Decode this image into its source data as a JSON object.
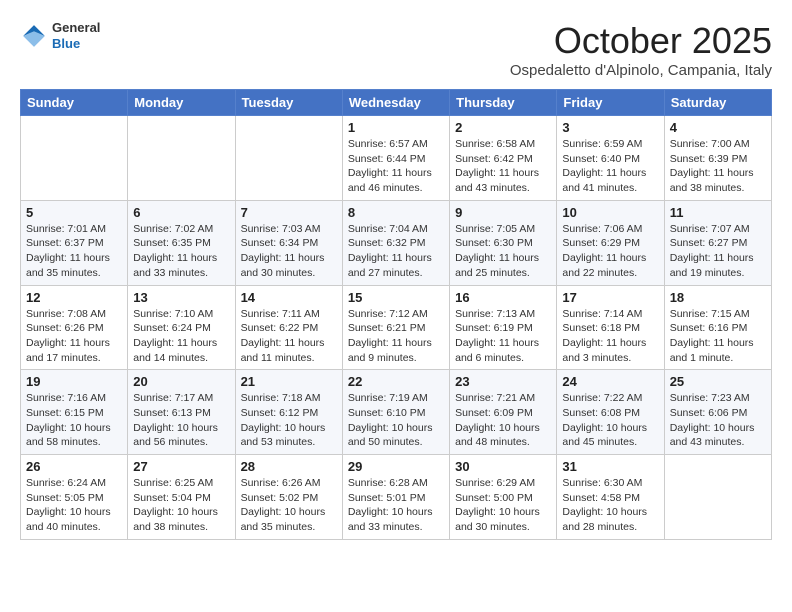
{
  "header": {
    "logo": {
      "general": "General",
      "blue": "Blue"
    },
    "title": "October 2025",
    "subtitle": "Ospedaletto d'Alpinolo, Campania, Italy"
  },
  "calendar": {
    "days_of_week": [
      "Sunday",
      "Monday",
      "Tuesday",
      "Wednesday",
      "Thursday",
      "Friday",
      "Saturday"
    ],
    "weeks": [
      [
        {
          "day": "",
          "info": ""
        },
        {
          "day": "",
          "info": ""
        },
        {
          "day": "",
          "info": ""
        },
        {
          "day": "1",
          "info": "Sunrise: 6:57 AM\nSunset: 6:44 PM\nDaylight: 11 hours and 46 minutes."
        },
        {
          "day": "2",
          "info": "Sunrise: 6:58 AM\nSunset: 6:42 PM\nDaylight: 11 hours and 43 minutes."
        },
        {
          "day": "3",
          "info": "Sunrise: 6:59 AM\nSunset: 6:40 PM\nDaylight: 11 hours and 41 minutes."
        },
        {
          "day": "4",
          "info": "Sunrise: 7:00 AM\nSunset: 6:39 PM\nDaylight: 11 hours and 38 minutes."
        }
      ],
      [
        {
          "day": "5",
          "info": "Sunrise: 7:01 AM\nSunset: 6:37 PM\nDaylight: 11 hours and 35 minutes."
        },
        {
          "day": "6",
          "info": "Sunrise: 7:02 AM\nSunset: 6:35 PM\nDaylight: 11 hours and 33 minutes."
        },
        {
          "day": "7",
          "info": "Sunrise: 7:03 AM\nSunset: 6:34 PM\nDaylight: 11 hours and 30 minutes."
        },
        {
          "day": "8",
          "info": "Sunrise: 7:04 AM\nSunset: 6:32 PM\nDaylight: 11 hours and 27 minutes."
        },
        {
          "day": "9",
          "info": "Sunrise: 7:05 AM\nSunset: 6:30 PM\nDaylight: 11 hours and 25 minutes."
        },
        {
          "day": "10",
          "info": "Sunrise: 7:06 AM\nSunset: 6:29 PM\nDaylight: 11 hours and 22 minutes."
        },
        {
          "day": "11",
          "info": "Sunrise: 7:07 AM\nSunset: 6:27 PM\nDaylight: 11 hours and 19 minutes."
        }
      ],
      [
        {
          "day": "12",
          "info": "Sunrise: 7:08 AM\nSunset: 6:26 PM\nDaylight: 11 hours and 17 minutes."
        },
        {
          "day": "13",
          "info": "Sunrise: 7:10 AM\nSunset: 6:24 PM\nDaylight: 11 hours and 14 minutes."
        },
        {
          "day": "14",
          "info": "Sunrise: 7:11 AM\nSunset: 6:22 PM\nDaylight: 11 hours and 11 minutes."
        },
        {
          "day": "15",
          "info": "Sunrise: 7:12 AM\nSunset: 6:21 PM\nDaylight: 11 hours and 9 minutes."
        },
        {
          "day": "16",
          "info": "Sunrise: 7:13 AM\nSunset: 6:19 PM\nDaylight: 11 hours and 6 minutes."
        },
        {
          "day": "17",
          "info": "Sunrise: 7:14 AM\nSunset: 6:18 PM\nDaylight: 11 hours and 3 minutes."
        },
        {
          "day": "18",
          "info": "Sunrise: 7:15 AM\nSunset: 6:16 PM\nDaylight: 11 hours and 1 minute."
        }
      ],
      [
        {
          "day": "19",
          "info": "Sunrise: 7:16 AM\nSunset: 6:15 PM\nDaylight: 10 hours and 58 minutes."
        },
        {
          "day": "20",
          "info": "Sunrise: 7:17 AM\nSunset: 6:13 PM\nDaylight: 10 hours and 56 minutes."
        },
        {
          "day": "21",
          "info": "Sunrise: 7:18 AM\nSunset: 6:12 PM\nDaylight: 10 hours and 53 minutes."
        },
        {
          "day": "22",
          "info": "Sunrise: 7:19 AM\nSunset: 6:10 PM\nDaylight: 10 hours and 50 minutes."
        },
        {
          "day": "23",
          "info": "Sunrise: 7:21 AM\nSunset: 6:09 PM\nDaylight: 10 hours and 48 minutes."
        },
        {
          "day": "24",
          "info": "Sunrise: 7:22 AM\nSunset: 6:08 PM\nDaylight: 10 hours and 45 minutes."
        },
        {
          "day": "25",
          "info": "Sunrise: 7:23 AM\nSunset: 6:06 PM\nDaylight: 10 hours and 43 minutes."
        }
      ],
      [
        {
          "day": "26",
          "info": "Sunrise: 6:24 AM\nSunset: 5:05 PM\nDaylight: 10 hours and 40 minutes."
        },
        {
          "day": "27",
          "info": "Sunrise: 6:25 AM\nSunset: 5:04 PM\nDaylight: 10 hours and 38 minutes."
        },
        {
          "day": "28",
          "info": "Sunrise: 6:26 AM\nSunset: 5:02 PM\nDaylight: 10 hours and 35 minutes."
        },
        {
          "day": "29",
          "info": "Sunrise: 6:28 AM\nSunset: 5:01 PM\nDaylight: 10 hours and 33 minutes."
        },
        {
          "day": "30",
          "info": "Sunrise: 6:29 AM\nSunset: 5:00 PM\nDaylight: 10 hours and 30 minutes."
        },
        {
          "day": "31",
          "info": "Sunrise: 6:30 AM\nSunset: 4:58 PM\nDaylight: 10 hours and 28 minutes."
        },
        {
          "day": "",
          "info": ""
        }
      ]
    ]
  }
}
